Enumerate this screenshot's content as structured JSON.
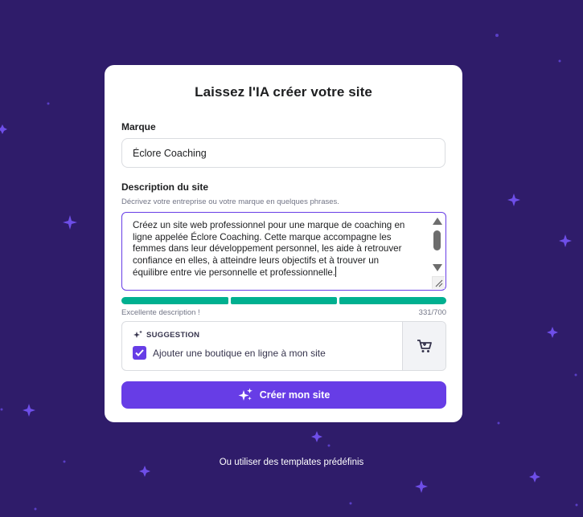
{
  "modal": {
    "title": "Laissez l'IA créer votre site",
    "brand_label": "Marque",
    "brand_value": "Éclore Coaching",
    "description_label": "Description du site",
    "description_hint": "Décrivez votre entreprise ou votre marque en quelques phrases.",
    "description_value": "Créez un site web professionnel pour une marque de coaching en ligne appelée Éclore Coaching. Cette marque accompagne les femmes dans leur développement personnel, les aide à retrouver confiance en elles, à atteindre leurs objectifs et à trouver un équilibre entre vie personnelle et professionnelle.",
    "quality_text": "Excellente description !",
    "char_count": "331/700",
    "quality_level": 1.0,
    "suggestion_heading": "SUGGESTION",
    "suggestion_text": "Ajouter une boutique en ligne à mon site",
    "suggestion_checked": true,
    "suggestion_icon": "cart-icon",
    "create_button_label": "Créer mon site"
  },
  "templates_link": "Ou utiliser des templates prédéfinis",
  "colors": {
    "background": "#2f1c6a",
    "accent": "#673de6",
    "success": "#00b090"
  }
}
